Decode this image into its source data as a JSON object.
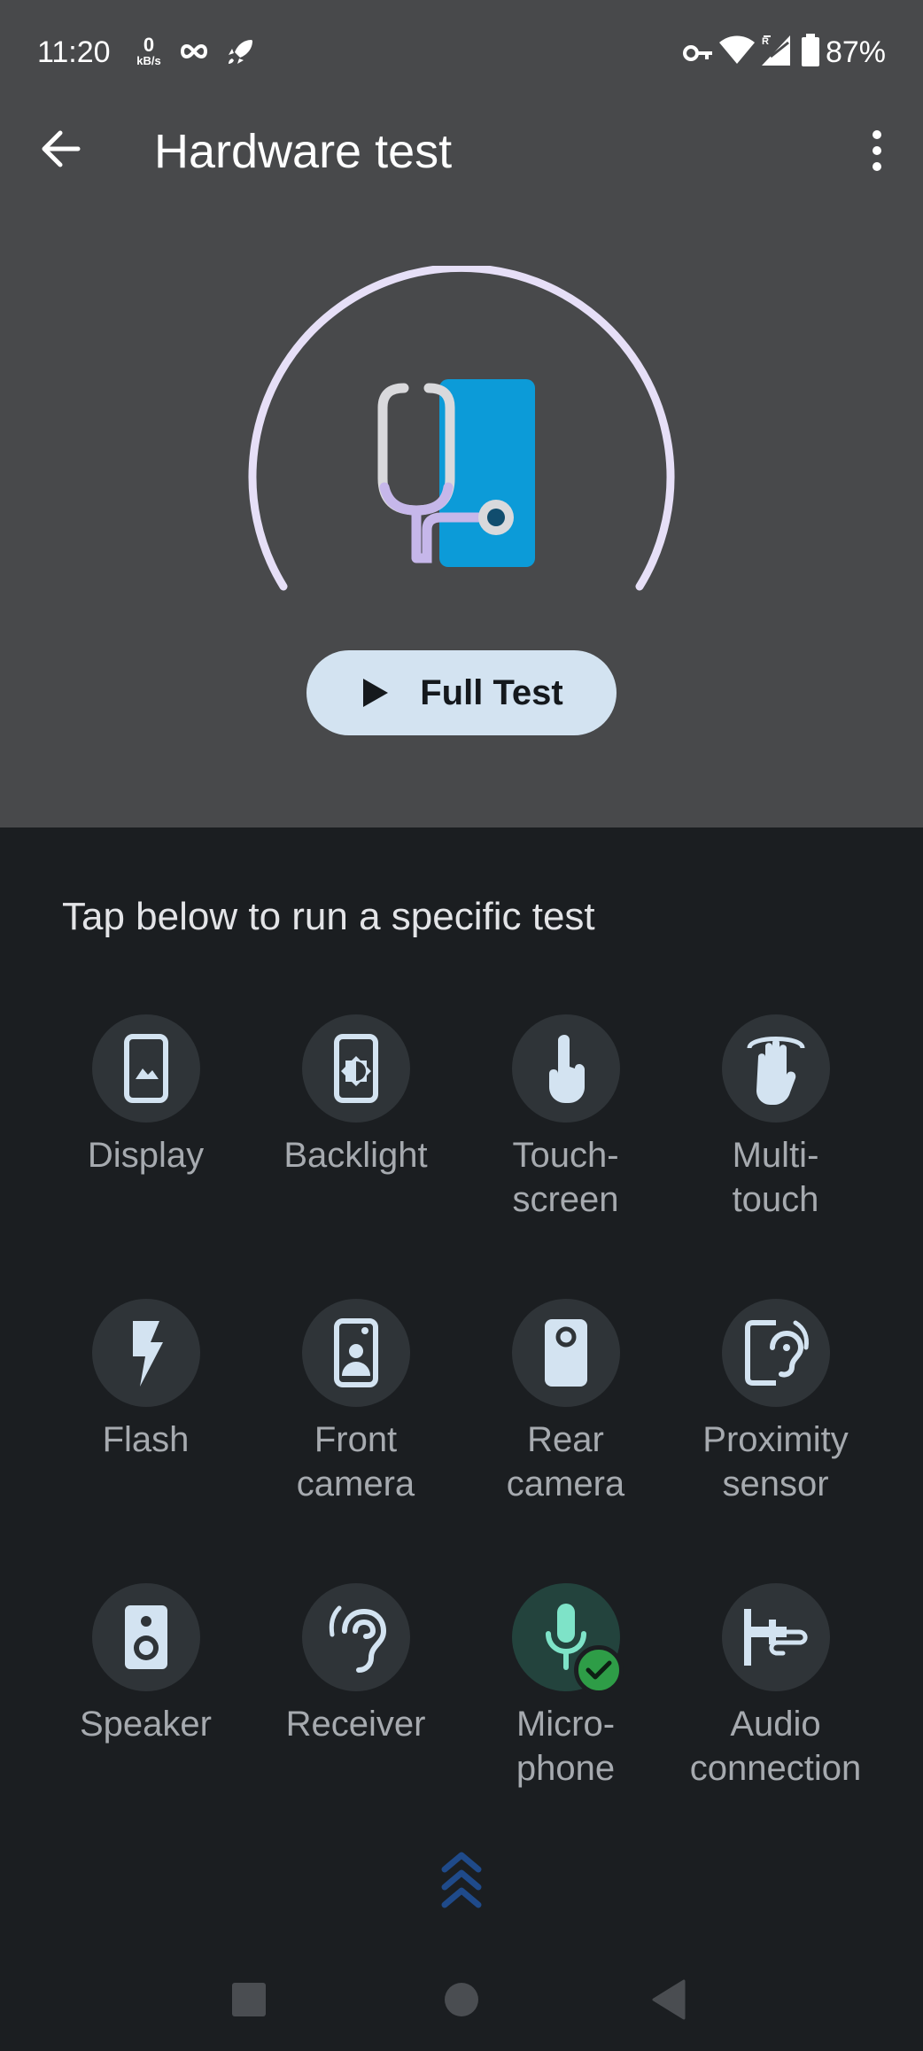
{
  "status_bar": {
    "time": "11:20",
    "net_speed_value": "0",
    "net_speed_unit": "kB/s",
    "battery_percent": "87%",
    "icons": [
      "infinity-icon",
      "rocket-icon",
      "vpn-key-icon",
      "wifi-icon",
      "signal-icon",
      "battery-icon"
    ]
  },
  "toolbar": {
    "title": "Hardware test",
    "back_icon": "arrow-back-icon",
    "more_icon": "more-vert-icon"
  },
  "hero": {
    "full_test_label": "Full Test"
  },
  "section": {
    "subtitle": "Tap below to run a specific test"
  },
  "tests": [
    {
      "line1": "Display",
      "line2": "",
      "icon": "display-icon"
    },
    {
      "line1": "Backlight",
      "line2": "",
      "icon": "backlight-icon"
    },
    {
      "line1": "Touch-",
      "line2": "screen",
      "icon": "touch-icon"
    },
    {
      "line1": "Multi-",
      "line2": "touch",
      "icon": "multi-touch-icon"
    },
    {
      "line1": "Flash",
      "line2": "",
      "icon": "flash-icon"
    },
    {
      "line1": "Front",
      "line2": "camera",
      "icon": "front-camera-icon"
    },
    {
      "line1": "Rear",
      "line2": "camera",
      "icon": "rear-camera-icon"
    },
    {
      "line1": "Proximity",
      "line2": "sensor",
      "icon": "proximity-icon"
    },
    {
      "line1": "Speaker",
      "line2": "",
      "icon": "speaker-icon"
    },
    {
      "line1": "Receiver",
      "line2": "",
      "icon": "ear-icon"
    },
    {
      "line1": "Micro-",
      "line2": "phone",
      "icon": "microphone-icon",
      "passed": true
    },
    {
      "line1": "Audio",
      "line2": "connection",
      "icon": "audio-jack-icon"
    }
  ],
  "colors": {
    "header_bg": "#48494b",
    "body_bg": "#1b1e21",
    "icon_tint": "#d3e3f1",
    "gauge_arc": "#e6dff7",
    "pass_green": "#2e9d47"
  }
}
